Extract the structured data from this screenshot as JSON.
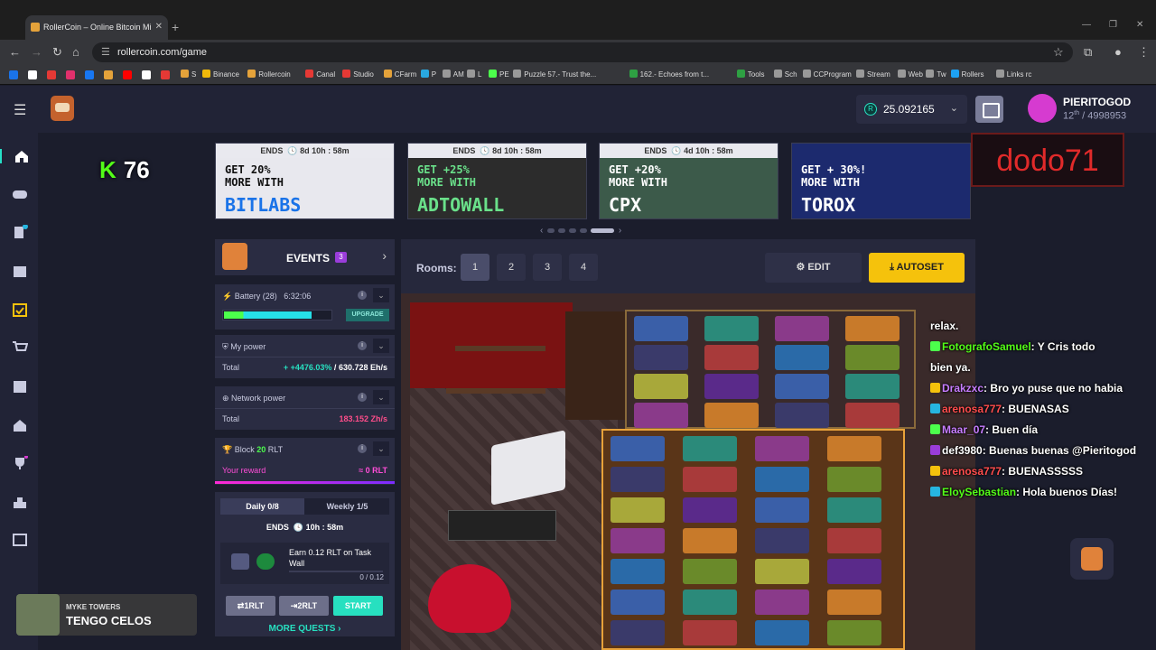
{
  "browser": {
    "tab_title": "RollerCoin – Online Bitcoin Mi",
    "url": "rollercoin.com/game",
    "bookmarks": [
      "S",
      "Binance",
      "Rollercoin",
      "Canal",
      "Studio",
      "CFarm",
      "P",
      "AM",
      "L",
      "PE",
      "Puzzle 57.- Trust the...",
      "162.- Echoes from t...",
      "Tools",
      "Sch",
      "CCProgram",
      "Stream",
      "Web",
      "Tw",
      "Rollers",
      "Links rc"
    ]
  },
  "header": {
    "balance": "25.092165",
    "currency_symbol": "R",
    "username": "PIERITOGOD",
    "rank_ordinal": "12",
    "rank_suffix": "th",
    "rank_total": "/ 4998953"
  },
  "overlay": {
    "kick_count": "76",
    "kick_letter": "K",
    "sign_text": "dodo71"
  },
  "banners": [
    {
      "ends": "ENDS",
      "time": "8d 10h : 58m",
      "line1": "GET 20%",
      "line2": "MORE WITH",
      "brand": "BITLABS",
      "bg": "#e8e8ee",
      "txt": "#111",
      "brandcolor": "#1a73e8"
    },
    {
      "ends": "ENDS",
      "time": "8d 10h : 58m",
      "line1": "GET +25%",
      "line2": "MORE WITH",
      "brand": "ADTOWALL",
      "bg": "#2c2c2c",
      "txt": "#6ae08a",
      "brandcolor": "#6ae08a"
    },
    {
      "ends": "ENDS",
      "time": "4d 10h : 58m",
      "line1": "GET +20%",
      "line2": "MORE WITH",
      "brand": "CPX",
      "bg": "#3c5a4a",
      "txt": "#ffffff",
      "brandcolor": "#ffffff"
    },
    {
      "ends": "",
      "time": "",
      "line1": "GET + 30%!",
      "line2": "MORE WITH",
      "brand": "TOROX",
      "bg": "#1c2a6e",
      "txt": "#ffffff",
      "brandcolor": "#ffffff"
    }
  ],
  "events": {
    "label": "EVENTS",
    "count": "3"
  },
  "battery": {
    "label": "Battery (28)",
    "time": "6:32:06",
    "upgrade": "UPGRADE",
    "level": 0.82
  },
  "my_power": {
    "label": "My power",
    "total_label": "Total",
    "bonus": "+ +4476.03%",
    "slash": "/",
    "value": "630.728 Eh/s"
  },
  "network_power": {
    "label": "Network power",
    "total_label": "Total",
    "value": "183.152 Zh/s"
  },
  "block": {
    "label": "Block",
    "amount": "20",
    "unit": "RLT",
    "reward_label": "Your reward",
    "reward_value": "≈ 0 RLT"
  },
  "quests": {
    "daily": "Daily 0/8",
    "weekly": "Weekly 1/5",
    "ends_label": "ENDS",
    "ends_time": "10h : 58m",
    "task": "Earn 0.12 RLT on Task Wall",
    "progress": "0 / 0.12",
    "btn1": "1RLT",
    "btn2": "2RLT",
    "btn3": "START",
    "more": "MORE QUESTS"
  },
  "rooms": {
    "label": "Rooms:",
    "items": [
      "1",
      "2",
      "3",
      "4"
    ],
    "edit": "EDIT",
    "autoset": "AUTOSET"
  },
  "chat": [
    {
      "user": "",
      "msg": "relax.",
      "color": "#ffffff"
    },
    {
      "user": "FotografoSamuel",
      "msg": ": Y Cris todo",
      "color": "#53fc18"
    },
    {
      "user": "",
      "msg": "bien ya.",
      "color": "#ffffff"
    },
    {
      "user": "Drakzxc",
      "msg": ": Bro yo puse que no habia",
      "color": "#c77dff"
    },
    {
      "user": "arenosa777",
      "msg": ": BUENASAS",
      "color": "#ff4d4d"
    },
    {
      "user": "Maar_07",
      "msg": ": Buen día",
      "color": "#c77dff"
    },
    {
      "user": "def3980",
      "msg": ": Buenas buenas @Pieritogod",
      "color": "#ffffff"
    },
    {
      "user": "arenosa777",
      "msg": ": BUENASSSSS",
      "color": "#ff4d4d"
    },
    {
      "user": "EloySebastian",
      "msg": ": Hola buenos Días!",
      "color": "#53fc18"
    }
  ],
  "music": {
    "artist": "MYKE TOWERS",
    "song": "TENGO CELOS"
  }
}
